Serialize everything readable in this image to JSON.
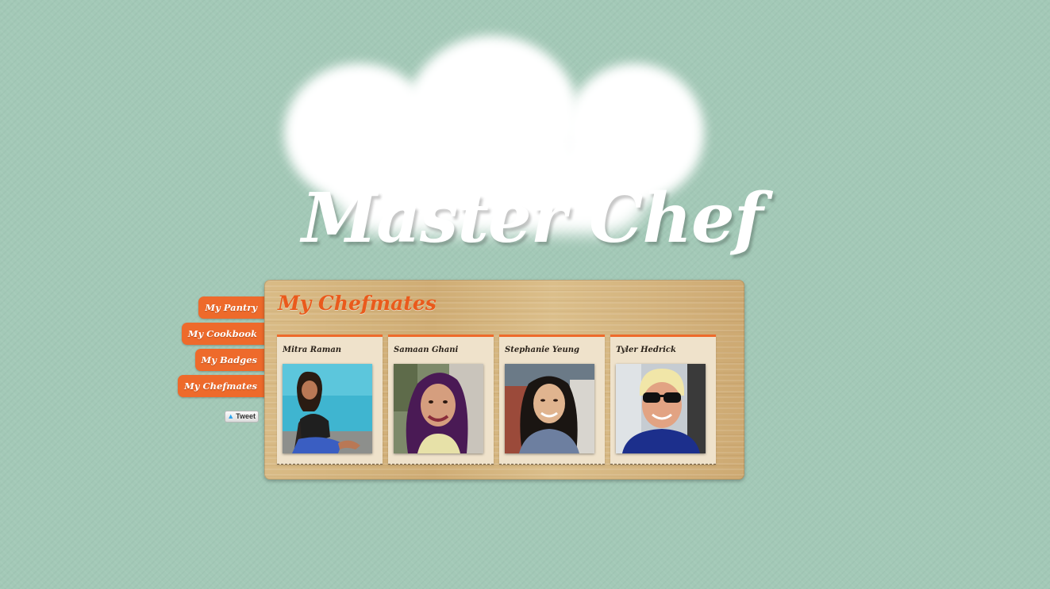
{
  "logo": {
    "title": "Master Chef",
    "icon": "chef-hat-icon"
  },
  "nav": {
    "items": [
      {
        "label": "My Pantry"
      },
      {
        "label": "My Cookbook"
      },
      {
        "label": "My Badges"
      },
      {
        "label": "My Chefmates"
      }
    ],
    "tweet_label": "Tweet",
    "tweet_icon": "twitter-bird-icon"
  },
  "board": {
    "title": "My Chefmates",
    "cards": [
      {
        "name": "Mitra Raman"
      },
      {
        "name": "Samaan Ghani"
      },
      {
        "name": "Stephanie Yeung"
      },
      {
        "name": "Tyler Hedrick"
      }
    ]
  },
  "colors": {
    "background": "#a3c9b7",
    "accent": "#ee6a2b",
    "title_orange": "#ea5a1c",
    "wood": "#d3b27c",
    "card": "#efe2cb"
  }
}
